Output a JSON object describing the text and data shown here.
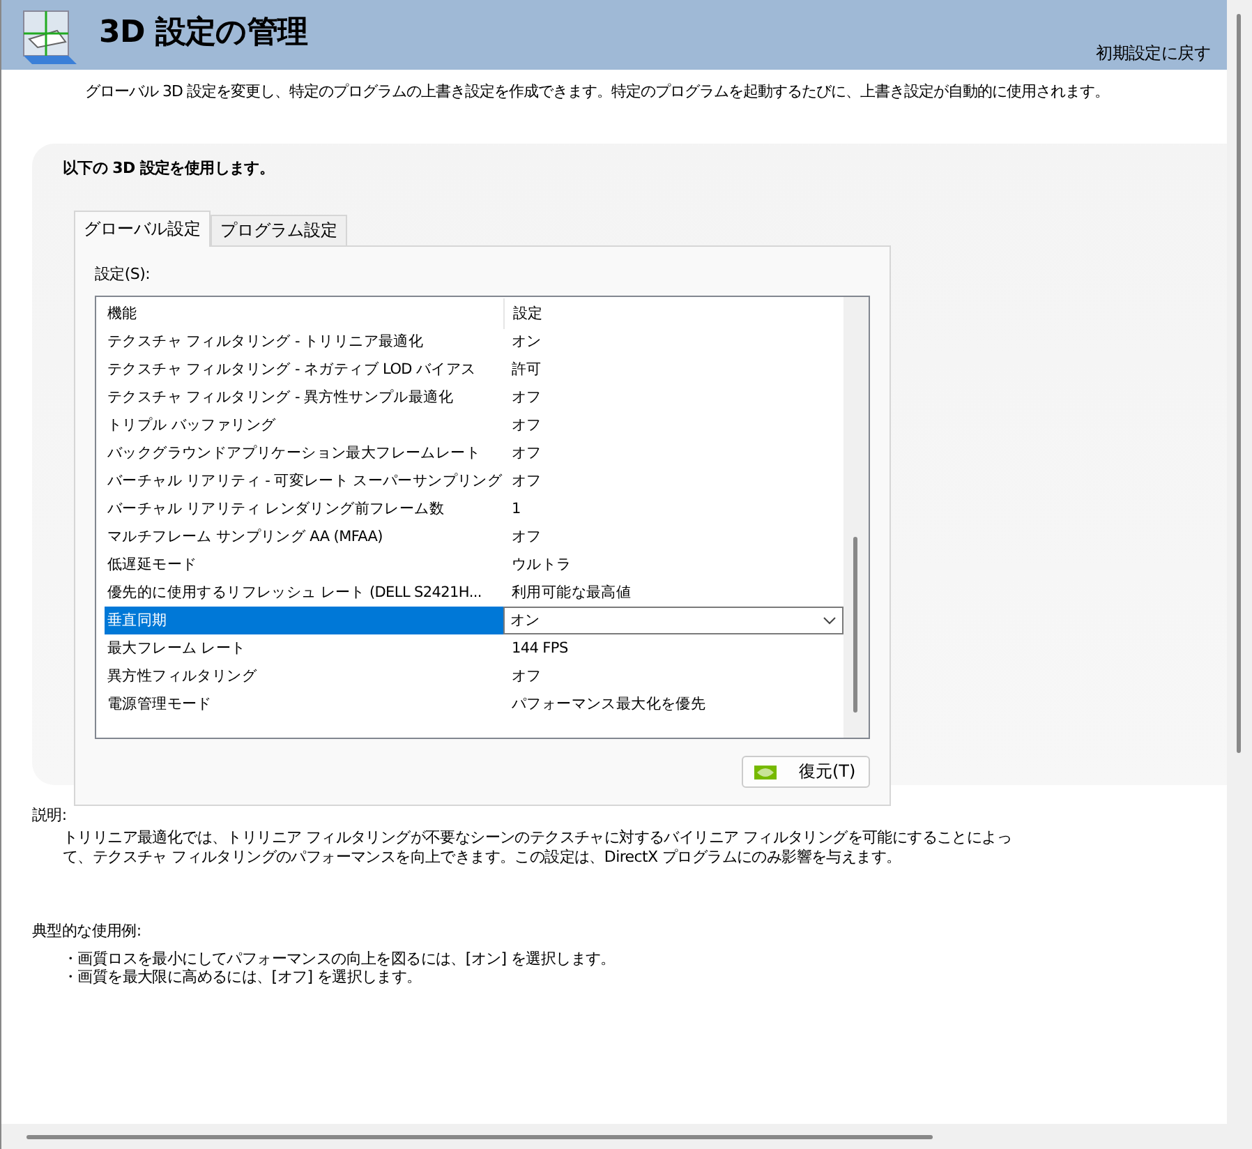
{
  "header": {
    "title": "3D 設定の管理",
    "restore_defaults": "初期設定に戻す"
  },
  "intro": "グローバル 3D 設定を変更し、特定のプログラムの上書き設定を作成できます。特定のプログラムを起動するたびに、上書き設定が自動的に使用されます。",
  "panel": {
    "heading": "以下の 3D 設定を使用します。",
    "tabs": [
      {
        "label": "グローバル設定",
        "selected": true
      },
      {
        "label": "プログラム設定",
        "selected": false
      }
    ],
    "settings_label": "設定(S):",
    "table": {
      "columns": [
        "機能",
        "設定"
      ],
      "rows": [
        {
          "feature": "テクスチャ フィルタリング - トリリニア最適化",
          "value": "オン",
          "selected": false
        },
        {
          "feature": "テクスチャ フィルタリング - ネガティブ LOD バイアス",
          "value": "許可",
          "selected": false
        },
        {
          "feature": "テクスチャ フィルタリング - 異方性サンプル最適化",
          "value": "オフ",
          "selected": false
        },
        {
          "feature": "トリプル バッファリング",
          "value": "オフ",
          "selected": false
        },
        {
          "feature": "バックグラウンドアプリケーション最大フレームレート",
          "value": "オフ",
          "selected": false
        },
        {
          "feature": "バーチャル リアリティ - 可変レート スーパーサンプリング",
          "value": "オフ",
          "selected": false
        },
        {
          "feature": "バーチャル リアリティ レンダリング前フレーム数",
          "value": "1",
          "selected": false
        },
        {
          "feature": "マルチフレーム サンプリング AA (MFAA)",
          "value": "オフ",
          "selected": false
        },
        {
          "feature": "低遅延モード",
          "value": "ウルトラ",
          "selected": false
        },
        {
          "feature": "優先的に使用するリフレッシュ レート (DELL S2421H...",
          "value": "利用可能な最高値",
          "selected": false
        },
        {
          "feature": "垂直同期",
          "value": "オン",
          "selected": true
        },
        {
          "feature": "最大フレーム レート",
          "value": "144 FPS",
          "selected": false
        },
        {
          "feature": "異方性フィルタリング",
          "value": "オフ",
          "selected": false
        },
        {
          "feature": "電源管理モード",
          "value": "パフォーマンス最大化を優先",
          "selected": false
        }
      ]
    },
    "restore_button": "復元(T)"
  },
  "description": {
    "label": "説明:",
    "text": "トリリニア最適化では、トリリニア フィルタリングが不要なシーンのテクスチャに対するバイリニア フィルタリングを可能にすることによって、テクスチャ フィルタリングのパフォーマンスを向上できます。この設定は、DirectX プログラムにのみ影響を与えます。"
  },
  "usage": {
    "label": "典型的な使用例:",
    "items": [
      "・画質ロスを最小にしてパフォーマンスの向上を図るには、[オン] を選択します。",
      "・画質を最大限に高めるには、[オフ] を選択します。"
    ]
  }
}
